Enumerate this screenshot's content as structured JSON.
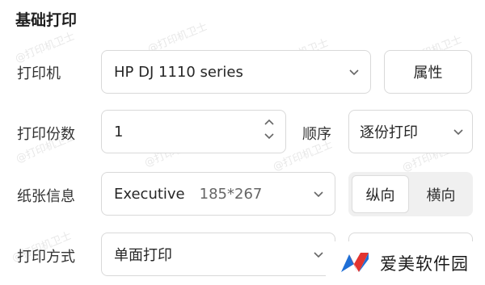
{
  "watermark_text": "@打印机卫士",
  "section": {
    "title": "基础打印"
  },
  "printer": {
    "label": "打印机",
    "selected": "HP DJ 1110 series",
    "properties_button": "属性"
  },
  "copies": {
    "label": "打印份数",
    "value": "1",
    "order_label": "顺序",
    "order_selected": "逐份打印"
  },
  "paper": {
    "label": "纸张信息",
    "size_name": "Executive",
    "size_dims": "185*267",
    "orientation": {
      "portrait": "纵向",
      "landscape": "横向",
      "selected": "portrait"
    }
  },
  "print_mode": {
    "label": "打印方式",
    "selected": "单面打印"
  },
  "brand": {
    "name": "爱美软件园"
  }
}
